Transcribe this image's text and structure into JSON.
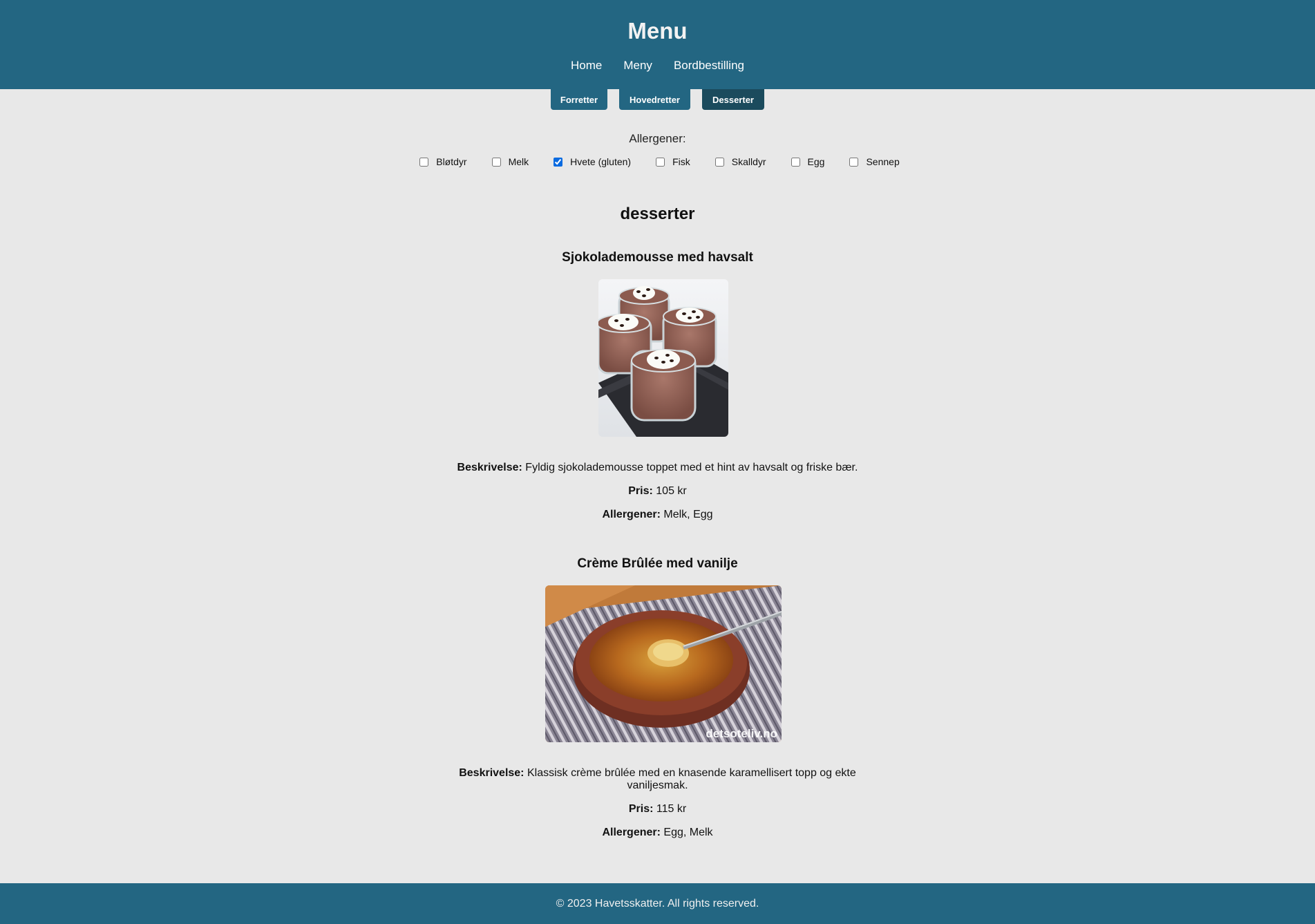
{
  "header": {
    "title": "Menu",
    "nav": [
      "Home",
      "Meny",
      "Bordbestilling"
    ]
  },
  "tabs": [
    {
      "label": "Forretter",
      "active": false
    },
    {
      "label": "Hovedretter",
      "active": false
    },
    {
      "label": "Desserter",
      "active": true
    }
  ],
  "filters": {
    "heading": "Allergener:",
    "items": [
      {
        "label": "Bløtdyr",
        "checked": false
      },
      {
        "label": "Melk",
        "checked": false
      },
      {
        "label": "Hvete (gluten)",
        "checked": true
      },
      {
        "label": "Fisk",
        "checked": false
      },
      {
        "label": "Skalldyr",
        "checked": false
      },
      {
        "label": "Egg",
        "checked": false
      },
      {
        "label": "Sennep",
        "checked": false
      }
    ]
  },
  "section": {
    "title": "desserter"
  },
  "labels": {
    "description": "Beskrivelse:",
    "price": "Pris:",
    "allergens": "Allergener:"
  },
  "dishes": [
    {
      "name": "Sjokolademousse med havsalt",
      "description": "Fyldig sjokolademousse toppet med et hint av havsalt og friske bær.",
      "price": "105 kr",
      "allergens": "Melk, Egg"
    },
    {
      "name": "Crème Brûlée med vanilje",
      "description": "Klassisk crème brûlée med en knasende karamellisert topp og ekte vaniljesmak.",
      "price": "115 kr",
      "allergens": "Egg, Melk",
      "image_watermark": "detsoteliv.no"
    }
  ],
  "footer": {
    "text": "© 2023 Havetsskatter. All rights reserved."
  },
  "colors": {
    "header": "#236682",
    "tab_active": "#1b4b5d",
    "background": "#e8e8e8"
  }
}
